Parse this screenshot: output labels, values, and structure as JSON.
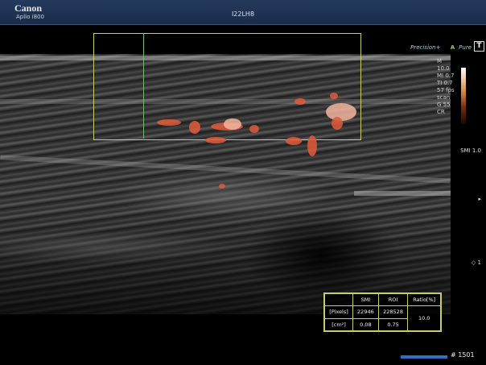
{
  "header": {
    "logo": "Canon",
    "model": "Aplio i800",
    "probe": "I22LH8"
  },
  "tags": {
    "precision": "Precision+",
    "apure": "Pure",
    "apure_prefix": "A",
    "t": "T"
  },
  "params": [
    "M",
    "10.0",
    "MI 0.7",
    "TI 0.7",
    "57 fps",
    "scan",
    "G 55",
    "CR"
  ],
  "markers": {
    "smi": "SMI 1.0",
    "p1": "1",
    "p2": "1"
  },
  "table": {
    "headers": [
      "",
      "SMI",
      "ROI",
      "Ratio[%]"
    ],
    "rows": [
      [
        "[Pixels]",
        "22946",
        "228528",
        "10.0"
      ],
      [
        "[cm²]",
        "0.08",
        "0.75",
        ""
      ]
    ]
  },
  "frame": "# 1501",
  "colors": {
    "header": "#1a2c48",
    "roi": "#c8cc6a",
    "flow": "#e05a3a",
    "bar": "#2f6fc8"
  }
}
